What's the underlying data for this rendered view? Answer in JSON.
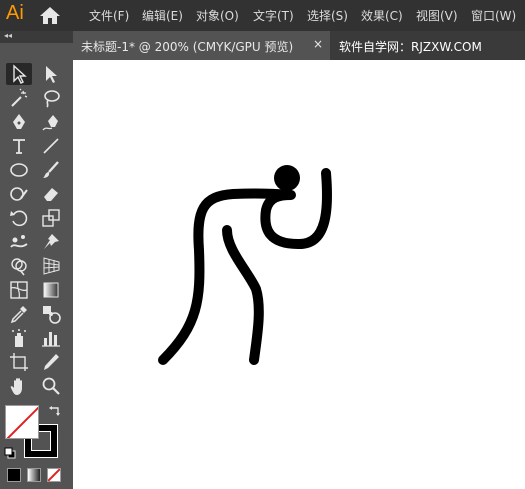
{
  "app": {
    "logo_text": "Ai"
  },
  "menu": [
    "文件(F)",
    "编辑(E)",
    "对象(O)",
    "文字(T)",
    "选择(S)",
    "效果(C)",
    "视图(V)",
    "窗口(W)"
  ],
  "tabs": {
    "active_label": "未标题-1* @ 200% (CMYK/GPU 预览)",
    "close_glyph": "×",
    "other_label": "软件自学网：RJZXW.COM"
  },
  "toolbar": {
    "collapse_glyph": "◂◂"
  },
  "colors": {
    "menubar_bg": "#323232",
    "panel_bg": "#535353",
    "canvas_bg": "#ffffff",
    "logo": "#ff9a00",
    "stroke_swatch_none_line": "#e02020",
    "artwork": "#000000"
  },
  "tools": [
    "selection-tool",
    "direct-selection-tool",
    "magic-wand-tool",
    "lasso-tool",
    "pen-tool",
    "curvature-tool",
    "type-tool",
    "line-segment-tool",
    "ellipse-tool",
    "paintbrush-tool",
    "shaper-tool",
    "eraser-tool",
    "rotate-tool",
    "scale-tool",
    "puppet-warp-tool",
    "pin-tool",
    "shape-builder-tool",
    "perspective-grid-tool",
    "mesh-tool",
    "gradient-tool",
    "eyedropper-tool",
    "blend-tool",
    "symbol-sprayer-tool",
    "column-graph-tool",
    "artboard-tool",
    "slice-tool",
    "hand-tool",
    "zoom-tool"
  ],
  "artwork": {
    "description_name": "running-figure-artwork"
  }
}
